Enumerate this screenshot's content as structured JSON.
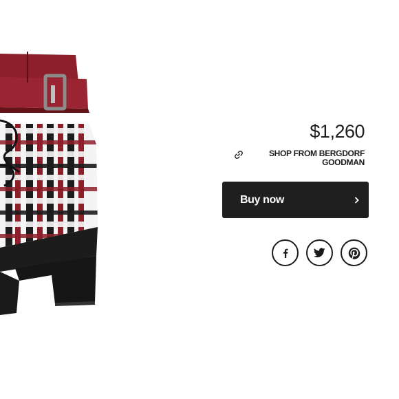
{
  "product": {
    "price": "$1,260",
    "retailer_link_label": "SHOP FROM BERGDORF GOODMAN",
    "buy_button_label": "Buy now"
  },
  "share": {
    "icons": [
      "facebook-icon",
      "twitter-icon",
      "pinterest-icon"
    ]
  },
  "colors": {
    "button_bg": "#1f1f1f",
    "text": "#1a1a1a",
    "boot_burgundy": "#8c1f2a",
    "boot_black": "#1c1c1c"
  }
}
